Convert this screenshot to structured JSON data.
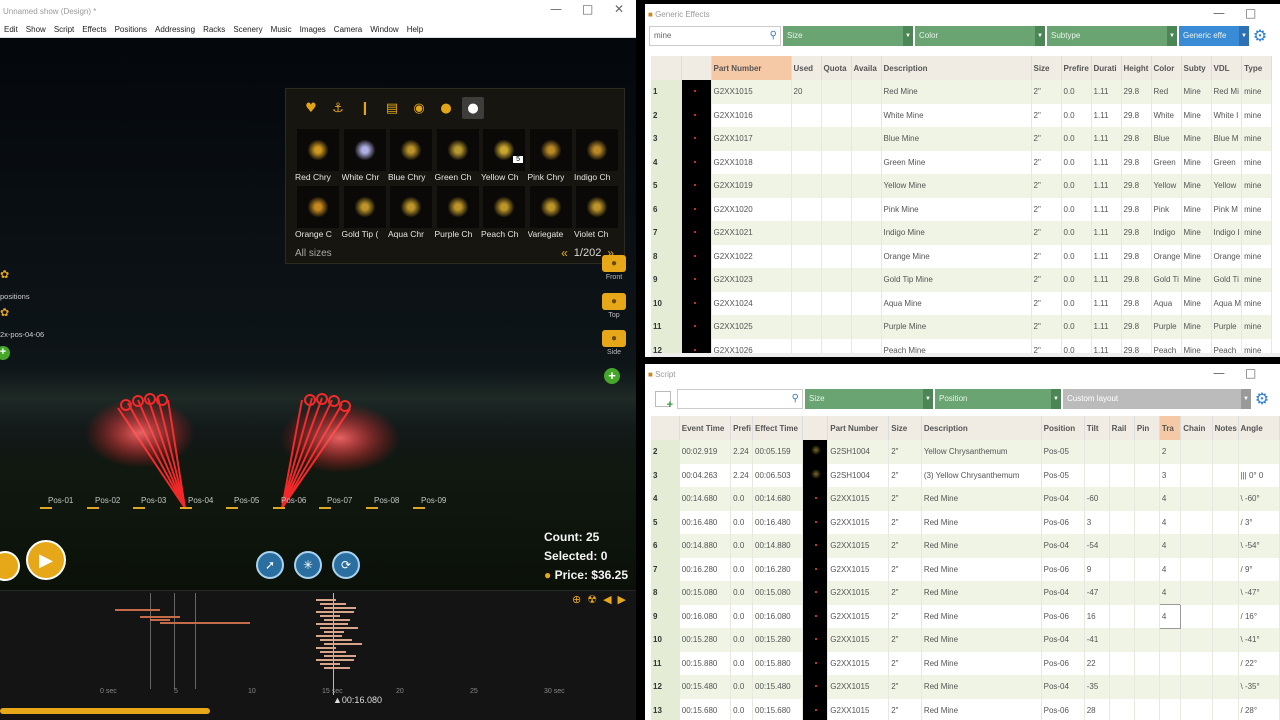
{
  "left_window": {
    "title": "Unnamed show (Design) *",
    "menu": [
      "Edit",
      "Show",
      "Script",
      "Effects",
      "Positions",
      "Addressing",
      "Racks",
      "Scenery",
      "Music",
      "Images",
      "Camera",
      "Window",
      "Help"
    ],
    "palette": {
      "tab_icons": [
        "heart-icon",
        "anchor-icon",
        "candle-icon",
        "cake-icon",
        "bag-icon",
        "pot-icon",
        "shell-icon"
      ],
      "effects": [
        {
          "label": "Red Chry",
          "color": "#d9a020"
        },
        {
          "label": "White Chr",
          "color": "#b9b9f0"
        },
        {
          "label": "Blue Chry",
          "color": "#c59a2a"
        },
        {
          "label": "Green Ch",
          "color": "#c0a030"
        },
        {
          "label": "Yellow Ch",
          "color": "#d4b030",
          "badge": "5"
        },
        {
          "label": "Pink Chry",
          "color": "#c49028"
        },
        {
          "label": "Indigo Ch",
          "color": "#c49028"
        },
        {
          "label": "Orange C",
          "color": "#d09020"
        },
        {
          "label": "Gold Tip (",
          "color": "#c69c2a"
        },
        {
          "label": "Aqua Chr",
          "color": "#c69c2a"
        },
        {
          "label": "Purple Ch",
          "color": "#c69c2a"
        },
        {
          "label": "Peach Ch",
          "color": "#c69c2a"
        },
        {
          "label": "Variegate",
          "color": "#c69c2a"
        },
        {
          "label": "Violet Ch",
          "color": "#c69c2a"
        }
      ],
      "sizes_label": "All sizes",
      "page": "1/202"
    },
    "cameras": [
      {
        "label": "Front"
      },
      {
        "label": "Top"
      },
      {
        "label": "Side"
      }
    ],
    "left_labels": {
      "positions": "positions",
      "group": "2x-pos-04-06"
    },
    "positions": [
      "Pos-01",
      "Pos-02",
      "Pos-03",
      "Pos-04",
      "Pos-05",
      "Pos-06",
      "Pos-07",
      "Pos-08",
      "Pos-09"
    ],
    "stats": {
      "count": "Count: 25",
      "selected": "Selected: 0",
      "price": "Price: $36.25"
    },
    "timeline": {
      "ticks": [
        "0 sec",
        "5",
        "10",
        "15 sec",
        "20",
        "25",
        "30 sec"
      ],
      "cursor": "00:16.080"
    }
  },
  "generic_effects": {
    "title": "Generic Effects",
    "search_value": "mine",
    "filters": [
      "Size",
      "Color",
      "Subtype",
      "Generic effe"
    ],
    "columns": [
      "",
      "",
      "Part Number",
      "Used",
      "Quota",
      "Availa",
      "Description",
      "Size",
      "Prefire",
      "Durati",
      "Height",
      "Color",
      "Subty",
      "VDL",
      "Type"
    ],
    "rows": [
      [
        "1",
        "",
        "G2XX1015",
        "20",
        "",
        "",
        "Red Mine",
        "2\"",
        "0.0",
        "1.11",
        "29.8",
        "Red",
        "Mine",
        "Red Mi",
        "mine"
      ],
      [
        "2",
        "",
        "G2XX1016",
        "",
        "",
        "",
        "White Mine",
        "2\"",
        "0.0",
        "1.11",
        "29.8",
        "White",
        "Mine",
        "White I",
        "mine"
      ],
      [
        "3",
        "",
        "G2XX1017",
        "",
        "",
        "",
        "Blue Mine",
        "2\"",
        "0.0",
        "1.11",
        "29.8",
        "Blue",
        "Mine",
        "Blue M",
        "mine"
      ],
      [
        "4",
        "",
        "G2XX1018",
        "",
        "",
        "",
        "Green Mine",
        "2\"",
        "0.0",
        "1.11",
        "29.8",
        "Green",
        "Mine",
        "Green",
        "mine"
      ],
      [
        "5",
        "",
        "G2XX1019",
        "",
        "",
        "",
        "Yellow Mine",
        "2\"",
        "0.0",
        "1.11",
        "29.8",
        "Yellow",
        "Mine",
        "Yellow",
        "mine"
      ],
      [
        "6",
        "",
        "G2XX1020",
        "",
        "",
        "",
        "Pink Mine",
        "2\"",
        "0.0",
        "1.11",
        "29.8",
        "Pink",
        "Mine",
        "Pink M",
        "mine"
      ],
      [
        "7",
        "",
        "G2XX1021",
        "",
        "",
        "",
        "Indigo Mine",
        "2\"",
        "0.0",
        "1.11",
        "29.8",
        "Indigo",
        "Mine",
        "Indigo I",
        "mine"
      ],
      [
        "8",
        "",
        "G2XX1022",
        "",
        "",
        "",
        "Orange Mine",
        "2\"",
        "0.0",
        "1.11",
        "29.8",
        "Orange",
        "Mine",
        "Orange",
        "mine"
      ],
      [
        "9",
        "",
        "G2XX1023",
        "",
        "",
        "",
        "Gold Tip Mine",
        "2\"",
        "0.0",
        "1.11",
        "29.8",
        "Gold Ti",
        "Mine",
        "Gold Ti",
        "mine"
      ],
      [
        "10",
        "",
        "G2XX1024",
        "",
        "",
        "",
        "Aqua Mine",
        "2\"",
        "0.0",
        "1.11",
        "29.8",
        "Aqua",
        "Mine",
        "Aqua M",
        "mine"
      ],
      [
        "11",
        "",
        "G2XX1025",
        "",
        "",
        "",
        "Purple Mine",
        "2\"",
        "0.0",
        "1.11",
        "29.8",
        "Purple",
        "Mine",
        "Purple",
        "mine"
      ],
      [
        "12",
        "",
        "G2XX1026",
        "",
        "",
        "",
        "Peach Mine",
        "2\"",
        "0.0",
        "1.11",
        "29.8",
        "Peach",
        "Mine",
        "Peach",
        "mine"
      ]
    ]
  },
  "script": {
    "title": "Script",
    "filters": [
      "Size",
      "Position",
      "Custom layout"
    ],
    "columns": [
      "",
      "Event Time",
      "Prefi",
      "Effect Time",
      "",
      "Part Number",
      "Size",
      "Description",
      "Position",
      "Tilt",
      "Rail",
      "Pin",
      "Tra",
      "Chain",
      "Notes",
      "Angle"
    ],
    "rows": [
      [
        "2",
        "00:02.919",
        "2.24",
        "00:05.159",
        "",
        "G2SH1004",
        "2\"",
        "Yellow Chrysanthemum",
        "Pos-05",
        "",
        "",
        "",
        "2",
        "",
        "",
        ""
      ],
      [
        "3",
        "00:04.263",
        "2.24",
        "00:06.503",
        "",
        "G2SH1004",
        "2\"",
        "(3) Yellow Chrysanthemum",
        "Pos-05",
        "",
        "",
        "",
        "3",
        "",
        "",
        "||| 0° 0"
      ],
      [
        "4",
        "00:14.680",
        "0.0",
        "00:14.680",
        "",
        "G2XX1015",
        "2\"",
        "Red Mine",
        "Pos-04",
        "-60",
        "",
        "",
        "4",
        "",
        "",
        "\\ -60°"
      ],
      [
        "5",
        "00:16.480",
        "0.0",
        "00:16.480",
        "",
        "G2XX1015",
        "2\"",
        "Red Mine",
        "Pos-06",
        "3",
        "",
        "",
        "4",
        "",
        "",
        "/ 3°"
      ],
      [
        "6",
        "00:14.880",
        "0.0",
        "00:14.880",
        "",
        "G2XX1015",
        "2\"",
        "Red Mine",
        "Pos-04",
        "-54",
        "",
        "",
        "4",
        "",
        "",
        "\\ -54°"
      ],
      [
        "7",
        "00:16.280",
        "0.0",
        "00:16.280",
        "",
        "G2XX1015",
        "2\"",
        "Red Mine",
        "Pos-06",
        "9",
        "",
        "",
        "4",
        "",
        "",
        "/ 9°"
      ],
      [
        "8",
        "00:15.080",
        "0.0",
        "00:15.080",
        "",
        "G2XX1015",
        "2\"",
        "Red Mine",
        "Pos-04",
        "-47",
        "",
        "",
        "4",
        "",
        "",
        "\\ -47°"
      ],
      [
        "9",
        "00:16.080",
        "0.0",
        "00:16.080",
        "",
        "G2XX1015",
        "2\"",
        "Red Mine",
        "Pos-06",
        "16",
        "",
        "",
        "4",
        "",
        "",
        "/ 16°"
      ],
      [
        "10",
        "00:15.280",
        "0.0",
        "00:15.280",
        "",
        "G2XX1015",
        "2\"",
        "Red Mine",
        "Pos-04",
        "-41",
        "",
        "",
        "",
        "",
        "",
        "\\ -41°"
      ],
      [
        "11",
        "00:15.880",
        "0.0",
        "00:15.880",
        "",
        "G2XX1015",
        "2\"",
        "Red Mine",
        "Pos-06",
        "22",
        "",
        "",
        "",
        "",
        "",
        "/ 22°"
      ],
      [
        "12",
        "00:15.480",
        "0.0",
        "00:15.480",
        "",
        "G2XX1015",
        "2\"",
        "Red Mine",
        "Pos-04",
        "-35",
        "",
        "",
        "",
        "",
        "",
        "\\ -35°"
      ],
      [
        "13",
        "00:15.680",
        "0.0",
        "00:15.680",
        "",
        "G2XX1015",
        "2\"",
        "Red Mine",
        "Pos-06",
        "28",
        "",
        "",
        "",
        "",
        "",
        "/ 28°"
      ]
    ]
  }
}
